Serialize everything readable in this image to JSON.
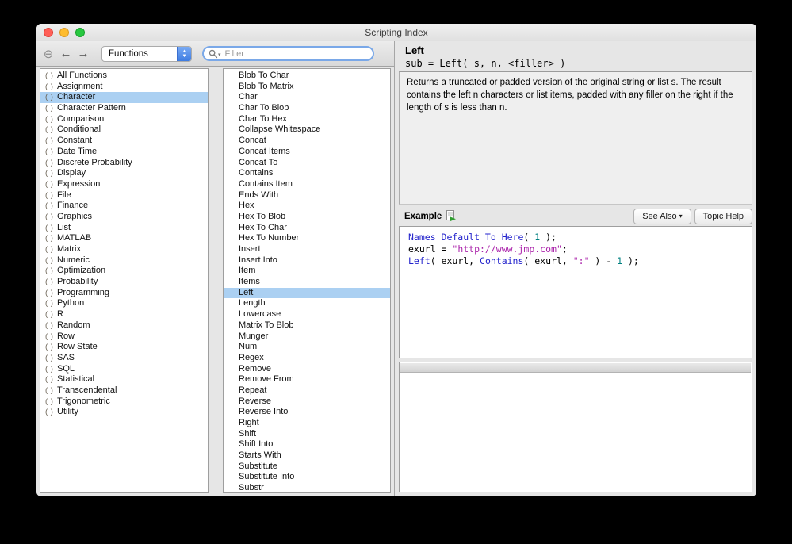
{
  "window": {
    "title": "Scripting Index"
  },
  "toolbar": {
    "nav": {
      "minus_glyph": "⊖",
      "back_glyph": "←",
      "forward_glyph": "→"
    },
    "dropdown_value": "Functions",
    "stepper_up": "▲",
    "stepper_down": "▼",
    "search_menu_arrow": "▾",
    "filter_placeholder": "Filter"
  },
  "categories": {
    "icon_glyph": "( )",
    "selected": "Character",
    "items": [
      "All Functions",
      "Assignment",
      "Character",
      "Character Pattern",
      "Comparison",
      "Conditional",
      "Constant",
      "Date Time",
      "Discrete Probability",
      "Display",
      "Expression",
      "File",
      "Finance",
      "Graphics",
      "List",
      "MATLAB",
      "Matrix",
      "Numeric",
      "Optimization",
      "Probability",
      "Programming",
      "Python",
      "R",
      "Random",
      "Row",
      "Row State",
      "SAS",
      "SQL",
      "Statistical",
      "Transcendental",
      "Trigonometric",
      "Utility"
    ]
  },
  "functions": {
    "selected": "Left",
    "items": [
      "Blob To Char",
      "Blob To Matrix",
      "Char",
      "Char To Blob",
      "Char To Hex",
      "Collapse Whitespace",
      "Concat",
      "Concat Items",
      "Concat To",
      "Contains",
      "Contains Item",
      "Ends With",
      "Hex",
      "Hex To Blob",
      "Hex To Char",
      "Hex To Number",
      "Insert",
      "Insert Into",
      "Item",
      "Items",
      "Left",
      "Length",
      "Lowercase",
      "Matrix To Blob",
      "Munger",
      "Num",
      "Regex",
      "Remove",
      "Remove From",
      "Repeat",
      "Reverse",
      "Reverse Into",
      "Right",
      "Shift",
      "Shift Into",
      "Starts With",
      "Substitute",
      "Substitute Into",
      "Substr"
    ]
  },
  "detail": {
    "title": "Left",
    "signature": "sub = Left( s, n, <filler> )",
    "description": "Returns a truncated or padded version of the original string or list s. The result contains the left n characters or list items, padded with any filler on the right if the length of s is less than n.",
    "example_label": "Example",
    "see_also_label": "See Also",
    "see_also_arrow": "▾",
    "topic_help_label": "Topic Help",
    "example_code": [
      [
        {
          "text": "Names Default To Here",
          "type": "kw"
        },
        {
          "text": "( ",
          "type": "pl"
        },
        {
          "text": "1",
          "type": "num"
        },
        {
          "text": " );",
          "type": "pl"
        }
      ],
      [
        {
          "text": "exurl = ",
          "type": "pl"
        },
        {
          "text": "\"http://www.jmp.com\"",
          "type": "str"
        },
        {
          "text": ";",
          "type": "pl"
        }
      ],
      [
        {
          "text": "Left",
          "type": "kw"
        },
        {
          "text": "( exurl, ",
          "type": "pl"
        },
        {
          "text": "Contains",
          "type": "kw"
        },
        {
          "text": "( exurl, ",
          "type": "pl"
        },
        {
          "text": "\":\"",
          "type": "str"
        },
        {
          "text": " ) - ",
          "type": "pl"
        },
        {
          "text": "1",
          "type": "num"
        },
        {
          "text": " );",
          "type": "pl"
        }
      ]
    ]
  },
  "colors": {
    "selection": "#abd0f2",
    "kw": "#2222cc",
    "str": "#aa22aa",
    "num": "#008080",
    "tl-red": "#ff5f57",
    "tl-yellow": "#febc2e",
    "tl-green": "#28c840"
  }
}
